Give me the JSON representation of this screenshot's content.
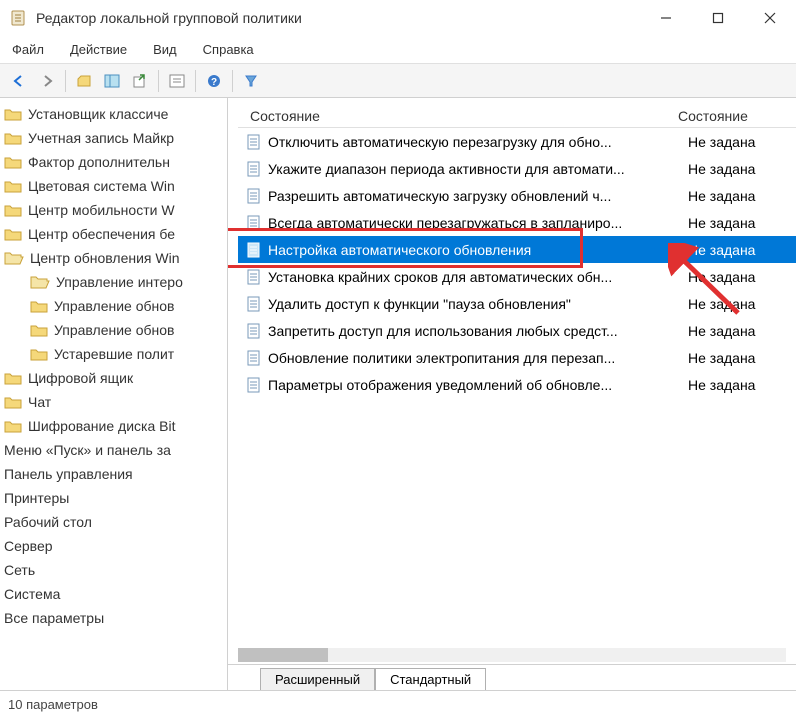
{
  "window": {
    "title": "Редактор локальной групповой политики"
  },
  "menu": {
    "file": "Файл",
    "action": "Действие",
    "view": "Вид",
    "help": "Справка"
  },
  "tree": {
    "items": [
      {
        "label": "Установщик классиче",
        "icon": "folder"
      },
      {
        "label": "Учетная запись Майкр",
        "icon": "folder"
      },
      {
        "label": "Фактор дополнительн",
        "icon": "folder"
      },
      {
        "label": "Цветовая система Win",
        "icon": "folder"
      },
      {
        "label": "Центр мобильности W",
        "icon": "folder"
      },
      {
        "label": "Центр обеспечения бе",
        "icon": "folder"
      },
      {
        "label": "Центр обновления Win",
        "icon": "folder-open"
      },
      {
        "label": "Управление интерo",
        "icon": "folder-open",
        "indent": true
      },
      {
        "label": "Управление обнов",
        "icon": "folder",
        "indent": true
      },
      {
        "label": "Управление обнов",
        "icon": "folder",
        "indent": true
      },
      {
        "label": "Устаревшие полит",
        "icon": "folder",
        "indent": true
      },
      {
        "label": "Цифровой ящик",
        "icon": "folder"
      },
      {
        "label": "Чат",
        "icon": "folder"
      },
      {
        "label": "Шифрование диска Bit",
        "icon": "folder"
      },
      {
        "label": "Меню «Пуск» и панель за",
        "icon": "none"
      },
      {
        "label": "Панель управления",
        "icon": "none"
      },
      {
        "label": "Принтеры",
        "icon": "none"
      },
      {
        "label": "Рабочий стол",
        "icon": "none"
      },
      {
        "label": "Сервер",
        "icon": "none"
      },
      {
        "label": "Сеть",
        "icon": "none"
      },
      {
        "label": "Система",
        "icon": "none"
      },
      {
        "label": "Все параметры",
        "icon": "none"
      }
    ]
  },
  "columns": {
    "c1": "Состояние",
    "c2": "Состояние"
  },
  "rows": [
    {
      "text": "Отключить автоматическую перезагрузку для обно...",
      "state": "Не задана",
      "selected": false
    },
    {
      "text": "Укажите диапазон периода активности для автомати...",
      "state": "Не задана",
      "selected": false
    },
    {
      "text": "Разрешить автоматическую загрузку обновлений ч...",
      "state": "Не задана",
      "selected": false
    },
    {
      "text": "Всегда автоматически перезагружаться в запланиро...",
      "state": "Не задана",
      "selected": false
    },
    {
      "text": "Настройка автоматического обновления",
      "state": "Не задана",
      "selected": true
    },
    {
      "text": "Установка крайних сроков для автоматических обн...",
      "state": "Не задана",
      "selected": false
    },
    {
      "text": "Удалить доступ к функции \"пауза обновления\"",
      "state": "Не задана",
      "selected": false
    },
    {
      "text": "Запретить доступ для использования любых средст...",
      "state": "Не задана",
      "selected": false
    },
    {
      "text": "Обновление политики электропитания для перезап...",
      "state": "Не задана",
      "selected": false
    },
    {
      "text": "Параметры отображения уведомлений об обновле...",
      "state": "Не задана",
      "selected": false
    }
  ],
  "tabs": {
    "extended": "Расширенный",
    "standard": "Стандартный"
  },
  "status": "10 параметров"
}
